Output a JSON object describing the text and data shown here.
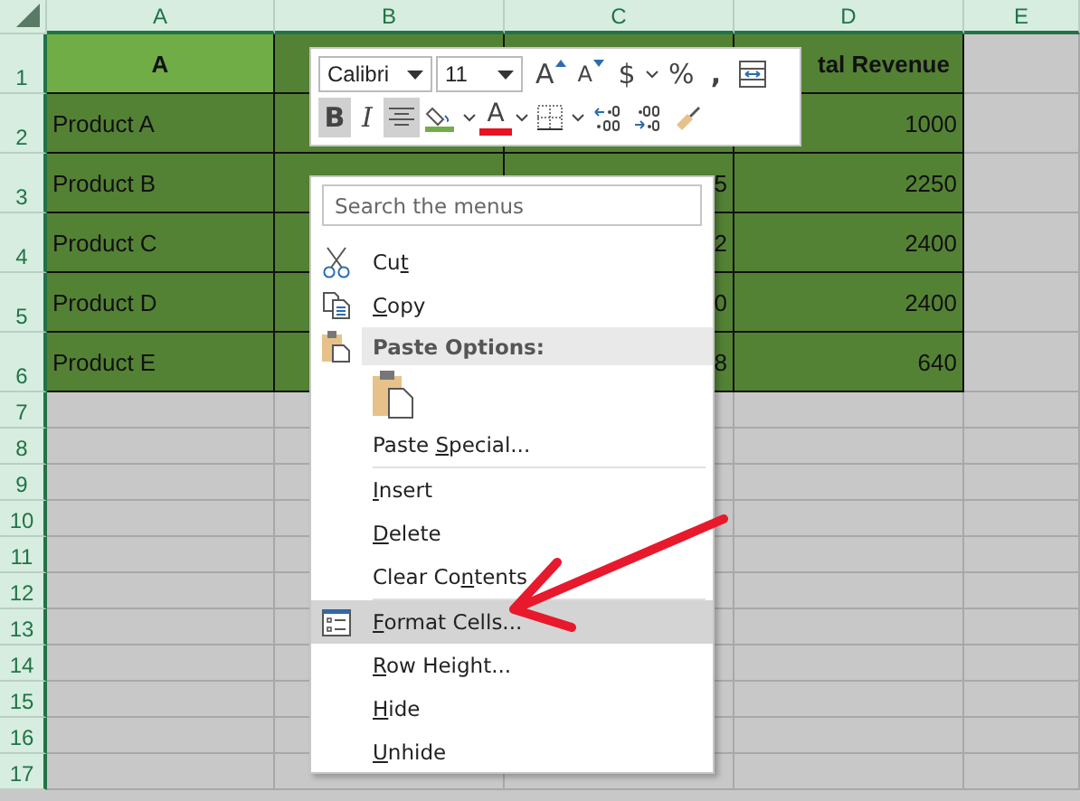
{
  "columns": [
    "A",
    "B",
    "C",
    "D",
    "E"
  ],
  "rows": [
    {
      "number": "1",
      "kind": "header",
      "cells": [
        "A",
        "",
        "",
        "tal Revenue",
        ""
      ]
    },
    {
      "number": "2",
      "kind": "data",
      "cells": [
        "Product A",
        "",
        "",
        "1000",
        ""
      ]
    },
    {
      "number": "3",
      "kind": "data",
      "cells": [
        "Product B",
        "",
        "5",
        "2250",
        ""
      ]
    },
    {
      "number": "4",
      "kind": "data",
      "cells": [
        "Product C",
        "",
        "2",
        "2400",
        ""
      ]
    },
    {
      "number": "5",
      "kind": "data",
      "cells": [
        "Product D",
        "",
        "0",
        "2400",
        ""
      ]
    },
    {
      "number": "6",
      "kind": "data",
      "cells": [
        "Product E",
        "",
        "8",
        "640",
        ""
      ]
    },
    {
      "number": "7",
      "kind": "empty"
    },
    {
      "number": "8",
      "kind": "empty"
    },
    {
      "number": "9",
      "kind": "empty"
    },
    {
      "number": "10",
      "kind": "empty"
    },
    {
      "number": "11",
      "kind": "empty"
    },
    {
      "number": "12",
      "kind": "empty"
    },
    {
      "number": "13",
      "kind": "empty"
    },
    {
      "number": "14",
      "kind": "empty"
    },
    {
      "number": "15",
      "kind": "empty"
    },
    {
      "number": "16",
      "kind": "empty"
    },
    {
      "number": "17",
      "kind": "empty"
    }
  ],
  "mini_toolbar": {
    "font": "Calibri",
    "size": "11",
    "row1": [
      {
        "kind": "grow",
        "label": "A"
      },
      {
        "kind": "shrink",
        "label": "A"
      },
      {
        "kind": "currency",
        "label": "$"
      },
      {
        "kind": "caret"
      },
      {
        "kind": "percent",
        "label": "%"
      },
      {
        "kind": "comma",
        "label": ","
      },
      {
        "kind": "wrap"
      }
    ],
    "row2": [
      {
        "kind": "bold",
        "label": "B",
        "selected": true
      },
      {
        "kind": "italic",
        "label": "I",
        "selected": false
      },
      {
        "kind": "align",
        "selected": true
      },
      {
        "kind": "fill"
      },
      {
        "kind": "caret"
      },
      {
        "kind": "fontcolor",
        "label": "A"
      },
      {
        "kind": "caret"
      },
      {
        "kind": "borders"
      },
      {
        "kind": "caret"
      },
      {
        "kind": "incdec"
      },
      {
        "kind": "decdec"
      },
      {
        "kind": "painter"
      }
    ]
  },
  "context_menu": {
    "search": {
      "placeholder": "Search the menus"
    },
    "items": [
      {
        "kind": "cut",
        "before": "Cu",
        "key": "t",
        "selected": false
      },
      {
        "kind": "copy",
        "key": "C",
        "after": "opy",
        "selected": false
      },
      {
        "kind": "section",
        "before": "Paste Options:",
        "selected": false
      },
      {
        "kind": "paste"
      },
      {
        "kind": "item",
        "before": "Paste ",
        "key": "S",
        "after": "pecial...",
        "selected": false,
        "divider_after": true
      },
      {
        "kind": "item",
        "key": "I",
        "after": "nsert",
        "selected": false
      },
      {
        "kind": "item",
        "key": "D",
        "after": "elete",
        "selected": false
      },
      {
        "kind": "item",
        "before": "Clear Co",
        "key": "n",
        "after": "tents",
        "selected": false,
        "divider_after": true
      },
      {
        "kind": "format",
        "key": "F",
        "after": "ormat Cells...",
        "selected": true
      },
      {
        "kind": "item",
        "key": "R",
        "after": "ow Height...",
        "selected": false
      },
      {
        "kind": "item",
        "key": "H",
        "after": "ide",
        "selected": false
      },
      {
        "kind": "item",
        "key": "U",
        "after": "nhide",
        "selected": false
      }
    ]
  }
}
